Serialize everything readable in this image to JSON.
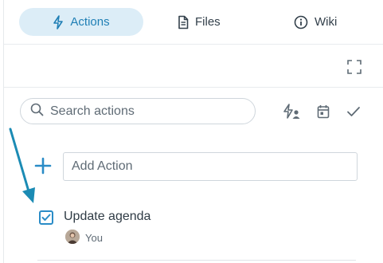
{
  "tabs": [
    {
      "label": "Actions",
      "icon": "lightning-icon",
      "active": true
    },
    {
      "label": "Files",
      "icon": "document-icon",
      "active": false
    },
    {
      "label": "Wiki",
      "icon": "info-circle-icon",
      "active": false
    }
  ],
  "toolbar": {
    "expand_icon": "expand-icon",
    "search_placeholder": "Search actions",
    "assign_icon": "assign-user-icon",
    "date_icon": "calendar-icon",
    "complete_icon": "checkmark-icon"
  },
  "add_action": {
    "placeholder": "Add Action",
    "icon": "plus-icon"
  },
  "actions": [
    {
      "title": "Update agenda",
      "checked": true,
      "owner": "You"
    }
  ],
  "colors": {
    "accent": "#2a8cc7",
    "active_tab_bg": "#dcedf7",
    "annotation_arrow": "#1b8bb4"
  }
}
